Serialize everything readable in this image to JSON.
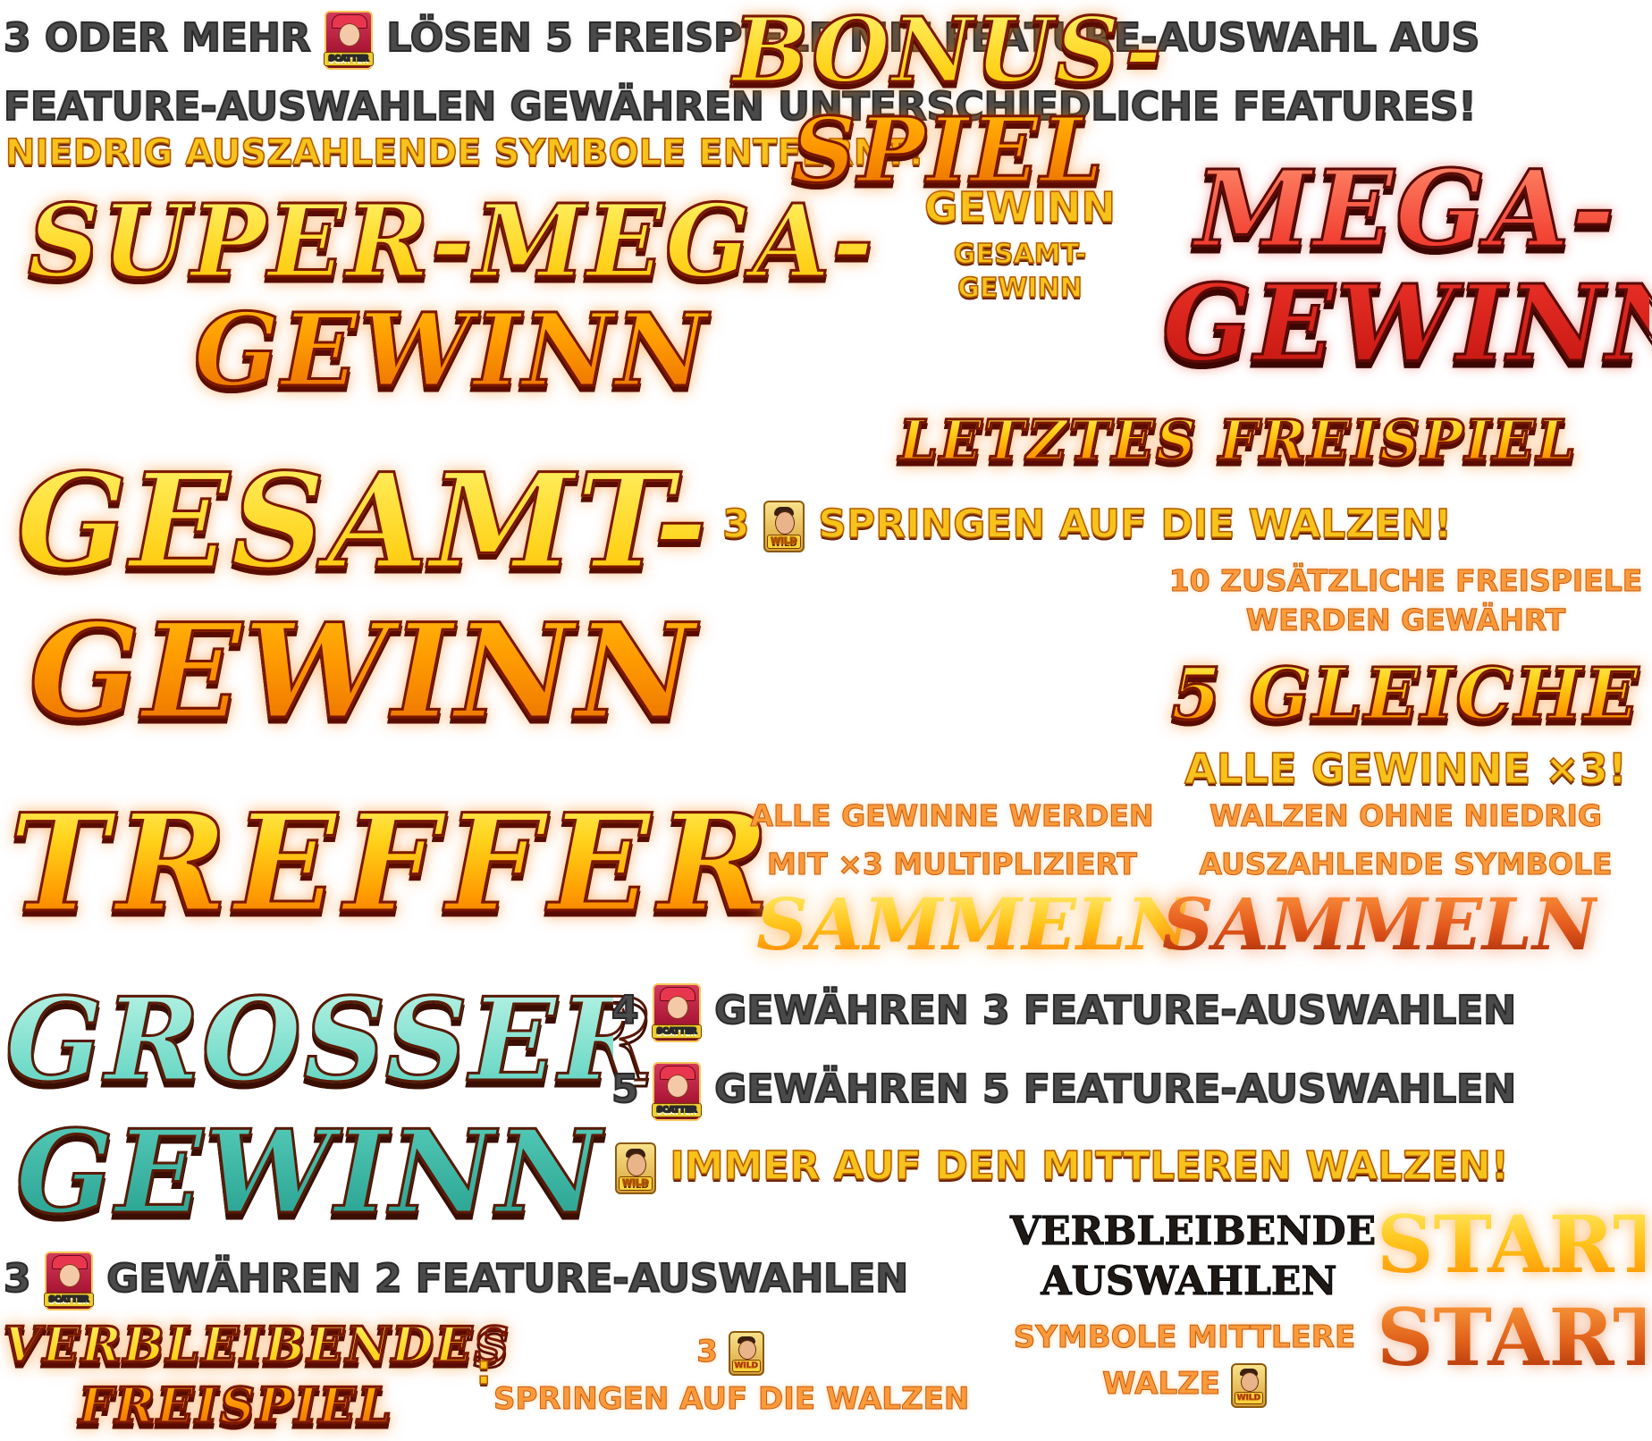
{
  "colors": {
    "background": "#ffffff",
    "gold": "#ffc21a",
    "red": "#e3301f",
    "teal": "#4cc7b4",
    "orange": "#fb9a3a",
    "grey": "#4a4a4a"
  },
  "icons": {
    "scatter_label": "SCATTER",
    "wild_label": "WILD"
  },
  "info": {
    "line1_prefix": "3 ODER MEHR",
    "line1_suffix": "LÖSEN 5 FREISPIELE MIT FEATURE-AUSWAHL AUS",
    "line2": "FEATURE-AUSWAHLEN GEWÄHREN UNTERSCHIEDLICHE FEATURES!",
    "line3": "NIEDRIG AUSZAHLENDE SYMBOLE ENTFERNT!"
  },
  "banners": {
    "super_mega_line1": "SUPER-MEGA-",
    "super_mega_line2": "GEWINN",
    "gewinn_small": "GEWINN",
    "gesamt_small_line1": "GESAMT-",
    "gesamt_small_line2": "GEWINN",
    "mega_line1": "MEGA-",
    "mega_line2": "GEWINN",
    "letztes_freispiel": "LETZTES FREISPIEL",
    "gesamt_line1": "GESAMT-",
    "gesamt_line2": "GEWINN",
    "wild_jump_prefix": "3",
    "wild_jump_suffix": "SPRINGEN AUF DIE WALZEN!",
    "bonus_line1": "BONUS-",
    "bonus_line2": "SPIEL",
    "extra_spins_line1": "10 ZUSÄTZLICHE FREISPIELE",
    "extra_spins_line2": "WERDEN GEWÄHRT",
    "five_same": "5 GLEICHE",
    "all_wins_x3": "ALLE GEWINNE ×3!",
    "treffer": "TREFFER",
    "multiplied_line1": "ALLE GEWINNE WERDEN",
    "multiplied_line2": "MIT ×3 MULTIPLIZIERT",
    "no_low_line1": "WALZEN OHNE NIEDRIG",
    "no_low_line2": "AUSZAHLENDE SYMBOLE",
    "sammeln_gold": "SAMMELN",
    "sammeln_red": "SAMMELN",
    "grosser_line1": "GROSSER",
    "grosser_line2": "GEWINN",
    "scatter4_prefix": "4",
    "scatter4_suffix": "GEWÄHREN 3 FEATURE-AUSWAHLEN",
    "scatter5_prefix": "5",
    "scatter5_suffix": "GEWÄHREN 5 FEATURE-AUSWAHLEN",
    "wild_middle": "IMMER AUF DEN MITTLEREN WALZEN!",
    "scatter3_prefix": "3",
    "scatter3_suffix": "GEWÄHREN 2 FEATURE-AUSWAHLEN",
    "remaining_picks_line1": "VERBLEIBENDE",
    "remaining_picks_line2": "AUSWAHLEN",
    "symbols_middle_line1": "SYMBOLE MITTLERE",
    "symbols_middle_line2": "WALZE",
    "start_gold": "START",
    "start_red": "START",
    "remaining_spin_line1": "VERBLEIBENDES",
    "remaining_spin_line2": "FREISPIEL",
    "colon": ":",
    "wild_jump_small_prefix": "3",
    "wild_jump_small_suffix": "SPRINGEN AUF DIE WALZEN"
  }
}
